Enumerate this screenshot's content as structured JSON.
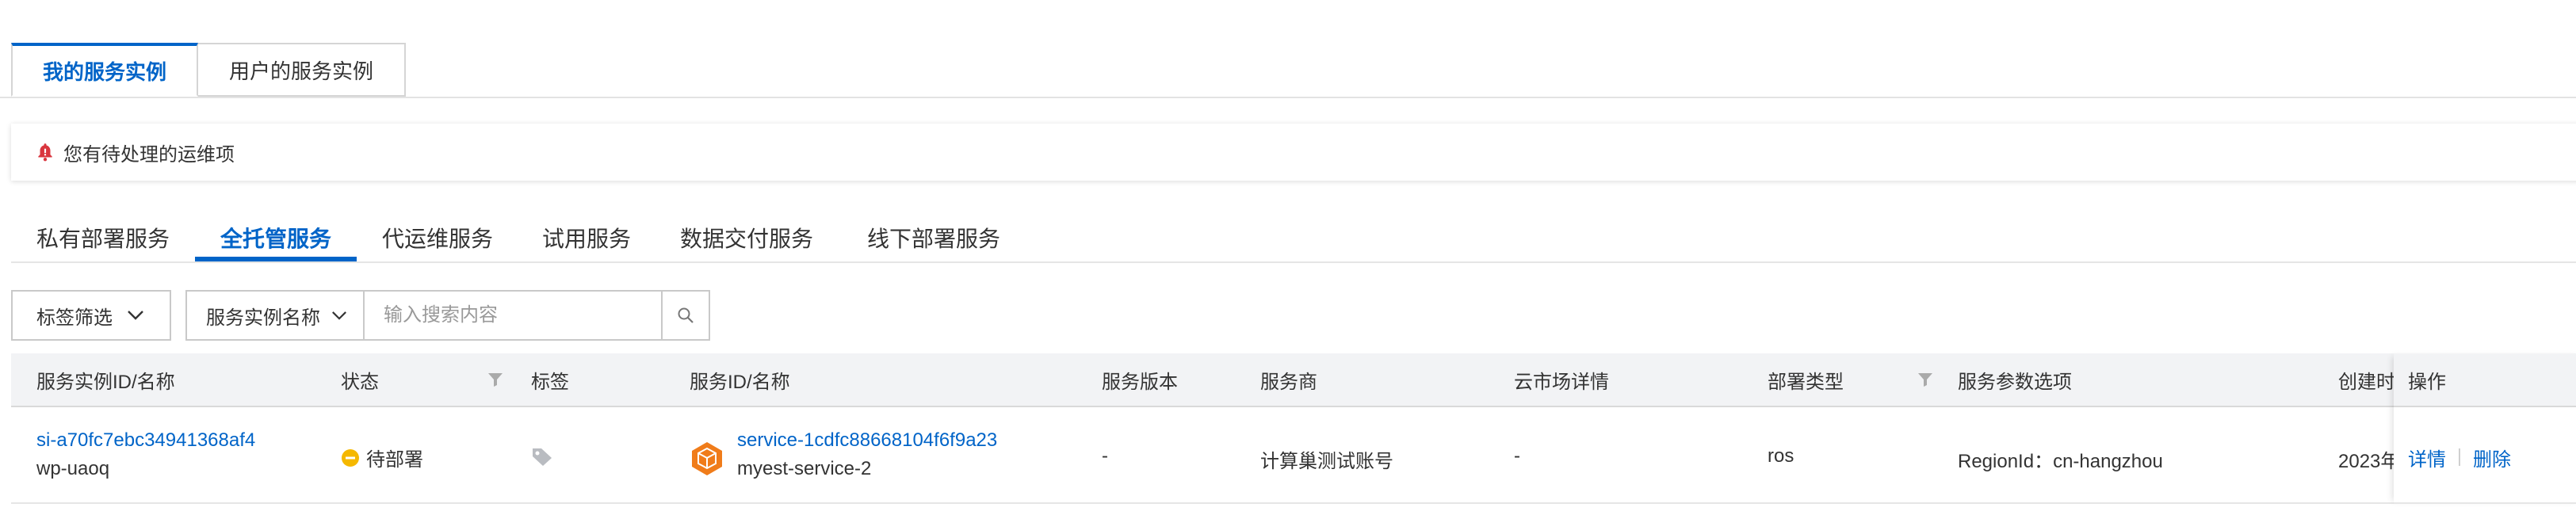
{
  "top_tabs": [
    {
      "label": "我的服务实例",
      "active": true
    },
    {
      "label": "用户的服务实例",
      "active": false
    }
  ],
  "notice": {
    "text": "您有待处理的运维项",
    "icon": "bell-icon",
    "icon_color": "#d9363e"
  },
  "sub_tabs": [
    {
      "label": "私有部署服务",
      "active": false
    },
    {
      "label": "全托管服务",
      "active": true
    },
    {
      "label": "代运维服务",
      "active": false
    },
    {
      "label": "试用服务",
      "active": false
    },
    {
      "label": "数据交付服务",
      "active": false
    },
    {
      "label": "线下部署服务",
      "active": false
    }
  ],
  "filters": {
    "tag_filter_label": "标签筛选",
    "search_field_label": "服务实例名称",
    "search_placeholder": "输入搜索内容"
  },
  "table": {
    "columns": [
      "服务实例ID/名称",
      "状态",
      "标签",
      "服务ID/名称",
      "服务版本",
      "服务商",
      "云市场详情",
      "部署类型",
      "服务参数选项",
      "创建时",
      "操作"
    ],
    "rows": [
      {
        "instance_id": "si-a70fc7ebc34941368af4",
        "instance_name": "wp-uaoq",
        "status": "待部署",
        "status_color": "#f5b800",
        "service_id": "service-1cdfc88668104f6f9a23",
        "service_name": "myest-service-2",
        "service_version": "-",
        "provider": "计算巢测试账号",
        "market_detail": "-",
        "deploy_type": "ros",
        "params": "RegionId：cn-hangzhou",
        "created": "2023年",
        "actions": [
          "详情",
          "删除"
        ]
      }
    ]
  },
  "colors": {
    "accent": "#0064c8",
    "header_bg": "#f2f3f5",
    "service_icon": "#f07c1a"
  }
}
